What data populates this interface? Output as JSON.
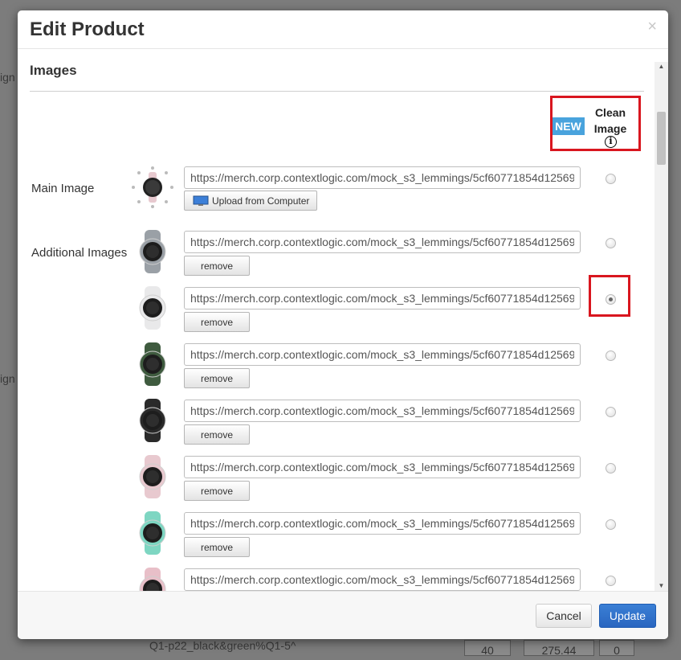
{
  "background": {
    "fragments": [
      "ign",
      "ign"
    ],
    "bottom_row": {
      "name": "Q1-p22_black&green%Q1-5^",
      "qty": "40",
      "price": "275.44",
      "count": "0"
    }
  },
  "modal": {
    "title": "Edit Product",
    "close_glyph": "×"
  },
  "images_section": {
    "title": "Images",
    "new_badge": "NEW",
    "clean_image_label_line1": "Clean",
    "clean_image_label_line2": "Image",
    "info_glyph": "i",
    "main_image_label": "Main Image",
    "additional_images_label": "Additional Images",
    "upload_button_label": "Upload from Computer",
    "remove_button_label": "remove",
    "main_image": {
      "url": "https://merch.corp.contextlogic.com/mock_s3_lemmings/5cf60771854d12569",
      "clean_selected": false
    },
    "additional_images": [
      {
        "url": "https://merch.corp.contextlogic.com/mock_s3_lemmings/5cf60771854d12569",
        "clean_selected": false,
        "watch_color": "#9aa0a6"
      },
      {
        "url": "https://merch.corp.contextlogic.com/mock_s3_lemmings/5cf60771854d12569",
        "clean_selected": true,
        "watch_color": "#e9e9ea"
      },
      {
        "url": "https://merch.corp.contextlogic.com/mock_s3_lemmings/5cf60771854d12569",
        "clean_selected": false,
        "watch_color": "#3f5b3f"
      },
      {
        "url": "https://merch.corp.contextlogic.com/mock_s3_lemmings/5cf60771854d12569",
        "clean_selected": false,
        "watch_color": "#2a2a2a"
      },
      {
        "url": "https://merch.corp.contextlogic.com/mock_s3_lemmings/5cf60771854d12569",
        "clean_selected": false,
        "watch_color": "#e8c9cf"
      },
      {
        "url": "https://merch.corp.contextlogic.com/mock_s3_lemmings/5cf60771854d12569",
        "clean_selected": false,
        "watch_color": "#7ed6c2"
      },
      {
        "url": "https://merch.corp.contextlogic.com/mock_s3_lemmings/5cf60771854d12569",
        "clean_selected": false,
        "watch_color": "#e8bfc8"
      }
    ]
  },
  "footer": {
    "cancel_label": "Cancel",
    "update_label": "Update"
  },
  "colors": {
    "new_badge": "#49a3dd",
    "highlight": "#d9161f",
    "primary_button": "#2a66c0"
  }
}
